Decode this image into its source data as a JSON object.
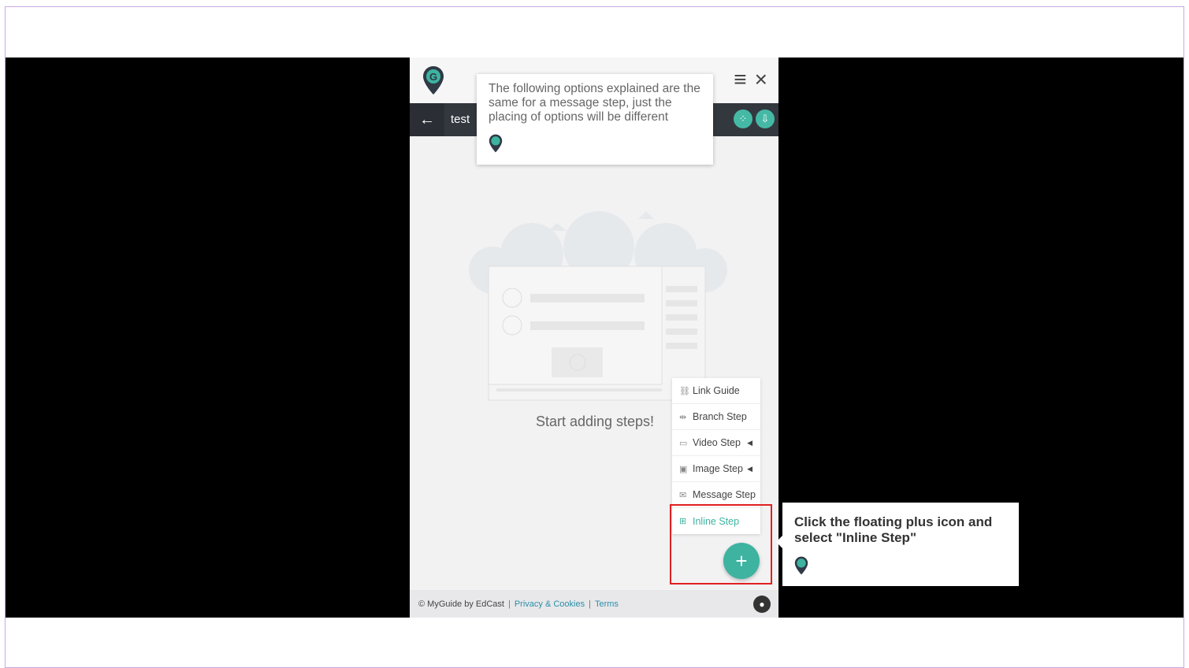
{
  "app": {
    "guide_title": "test",
    "empty_message": "Start adding steps!",
    "menu": [
      {
        "label": "Link Guide",
        "icon": "link-icon",
        "has_submenu": false
      },
      {
        "label": "Branch Step",
        "icon": "branch-icon",
        "has_submenu": false
      },
      {
        "label": "Video Step",
        "icon": "video-icon",
        "has_submenu": true
      },
      {
        "label": "Image Step",
        "icon": "image-icon",
        "has_submenu": true
      },
      {
        "label": "Message Step",
        "icon": "message-icon",
        "has_submenu": false
      },
      {
        "label": "Inline Step",
        "icon": "inline-step-icon",
        "has_submenu": false,
        "active": true
      }
    ],
    "fab_label": "+",
    "footer": {
      "copyright": "© MyGuide by EdCast",
      "privacy": "Privacy & Cookies",
      "terms": "Terms",
      "separator": "|"
    }
  },
  "tooltips": {
    "top": "The following options explained are the same for a message step, just the placing of options will be different",
    "bottom": "Click the floating plus icon and select \"Inline Step\""
  },
  "colors": {
    "accent": "#3db3a0",
    "header_bar": "#33383f",
    "highlight": "#e02020",
    "frame_border": "#c9a8e6"
  }
}
